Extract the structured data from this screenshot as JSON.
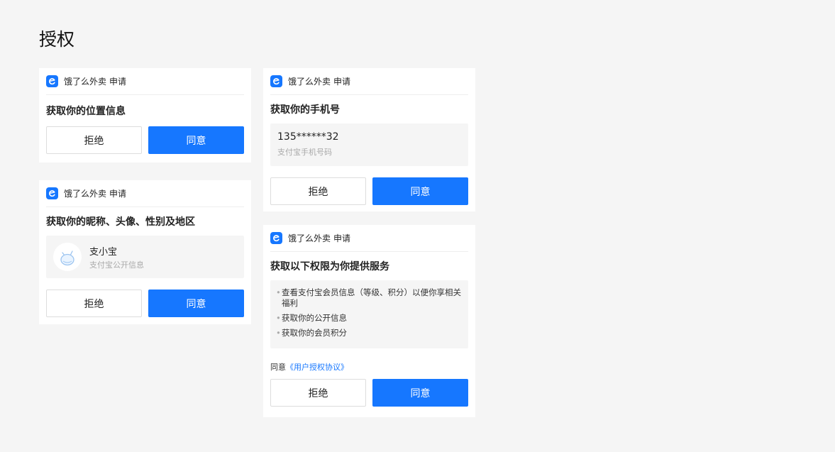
{
  "page": {
    "title": "授权"
  },
  "app": {
    "name": "饿了么外卖",
    "apply": "申请",
    "logo_color": "#1677ff",
    "logo_icon": "e-logo-icon"
  },
  "buttons": {
    "reject": "拒绝",
    "agree": "同意",
    "agree_color": "#1677ff"
  },
  "location_card": {
    "title": "获取你的位置信息"
  },
  "profile_card": {
    "title": "获取你的昵称、头像、性别及地区",
    "avatar_icon": "mascot-avatar-icon",
    "nickname": "支小宝",
    "subtitle": "支付宝公开信息"
  },
  "phone_card": {
    "title": "获取你的手机号",
    "number": "135******32",
    "subtitle": "支付宝手机号码"
  },
  "permissions_card": {
    "title": "获取以下权限为你提供服务",
    "items": [
      "查看支付宝会员信息（等级、积分）以便你享相关福利",
      "获取你的公开信息",
      "获取你的会员积分"
    ],
    "agree_prefix": "同意",
    "agreement_link": "《用户授权协议》"
  }
}
